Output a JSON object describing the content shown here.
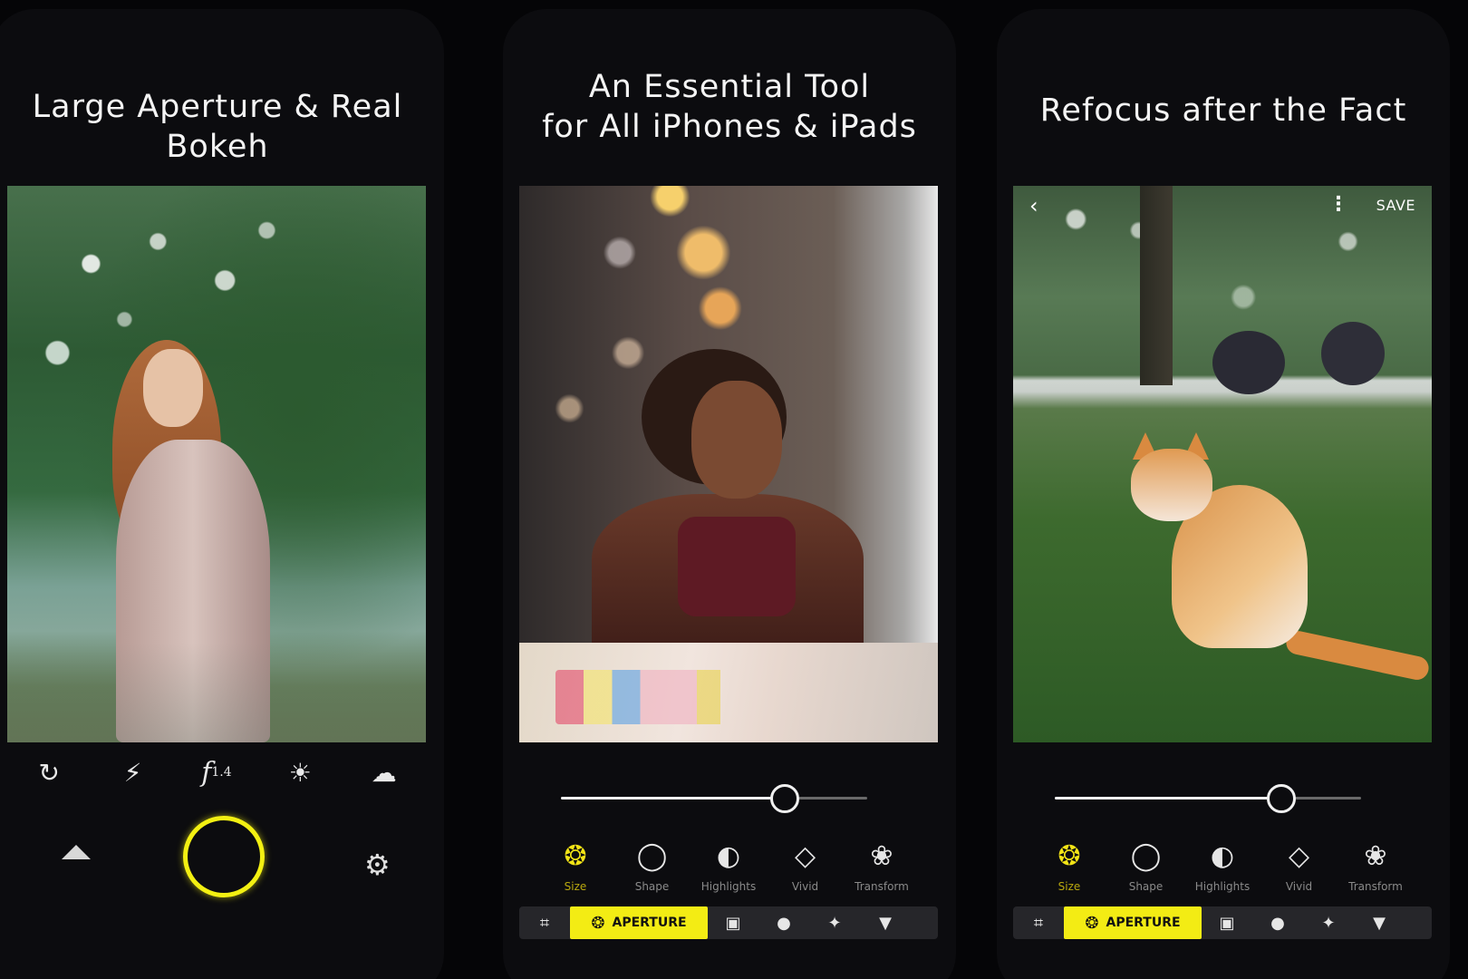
{
  "panels": [
    {
      "headline": "Large Aperture & Real Bokeh",
      "camera_icons": [
        "rotate-camera-icon",
        "flash-off-icon",
        "aperture-fstop-icon",
        "exposure-icon",
        "cloud-icon"
      ],
      "fstop": {
        "prefix": "f",
        "value": "1.4"
      }
    },
    {
      "headline": "An Essential Tool\nfor All iPhones & iPads",
      "slider_value": 0.73
    },
    {
      "headline": "Refocus after the Fact",
      "save_label": "SAVE",
      "slider_value": 0.74
    }
  ],
  "tools": [
    {
      "label": "Size",
      "icon": "aperture-icon",
      "active": true
    },
    {
      "label": "Shape",
      "icon": "circle-icon",
      "active": false
    },
    {
      "label": "Highlights",
      "icon": "highlights-icon",
      "active": false
    },
    {
      "label": "Vivid",
      "icon": "paint-bucket-icon",
      "active": false
    },
    {
      "label": "Transform",
      "icon": "flower-icon",
      "active": false
    }
  ],
  "bottom_bar": {
    "aperture_label": "APERTURE",
    "icons": [
      "crop-icon",
      "aperture-icon",
      "film-icon",
      "bulb-icon",
      "magic-wand-icon",
      "banner-icon"
    ]
  },
  "colors": {
    "accent": "#f3ec14",
    "background": "#050507",
    "panel": "#0c0c0f"
  }
}
